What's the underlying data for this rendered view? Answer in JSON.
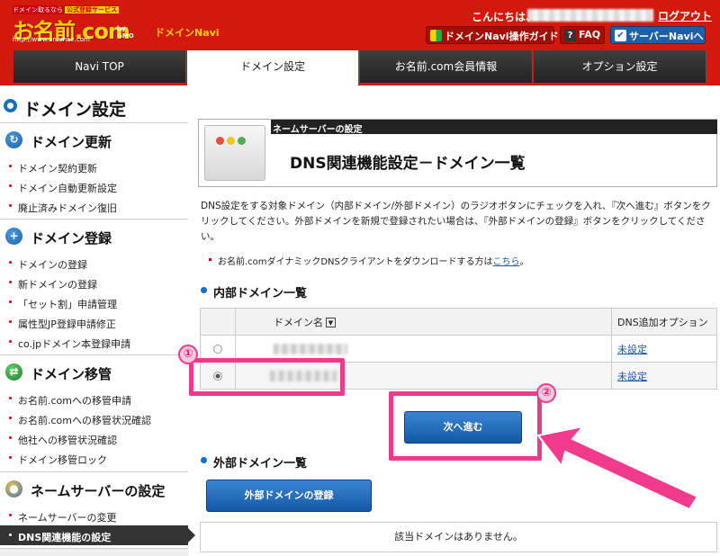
{
  "header": {
    "logo_tagline": "ドメイン取るなら",
    "logo_tagline_badge": "公式登録サービス",
    "logo_main": "お名前.com",
    "logo_gmo": "by GMO",
    "logo_url": "http://www.onamae.com",
    "navi_name": "ドメインNavi",
    "greeting": "こんにちは、",
    "logout": "ログアウト",
    "buttons": [
      {
        "label": "ドメインNavi操作ガイド",
        "icon": "beginner-mark-icon"
      },
      {
        "label": "FAQ",
        "icon": "question-icon"
      },
      {
        "label": "サーバーNaviへ",
        "icon": "server-check-icon"
      }
    ]
  },
  "tabs": [
    {
      "label": "Navi TOP",
      "active": false
    },
    {
      "label": "ドメイン設定",
      "active": true
    },
    {
      "label": "お名前.com会員情報",
      "active": false
    },
    {
      "label": "オプション設定",
      "active": false
    }
  ],
  "page_title": "ドメイン設定",
  "sidebar": {
    "sections": [
      {
        "title": "ドメイン更新",
        "icon": "refresh-icon",
        "items": [
          "ドメイン契約更新",
          "ドメイン自動更新設定",
          "廃止済みドメイン復旧"
        ]
      },
      {
        "title": "ドメイン登録",
        "icon": "plus-icon",
        "items": [
          "ドメインの登録",
          "新ドメインの登録",
          "「セット割」申請管理",
          "属性型JP登録申請修正",
          "co.jpドメイン本登録申請"
        ]
      },
      {
        "title": "ドメイン移管",
        "icon": "transfer-icon",
        "items": [
          "お名前.comへの移管申請",
          "お名前.comへの移管状況確認",
          "他社への移管状況確認",
          "ドメイン移管ロック"
        ]
      },
      {
        "title": "ネームサーバーの設定",
        "icon": "users-icon",
        "items": [
          "ネームサーバーの変更",
          "DNS関連機能の設定"
        ]
      }
    ],
    "active_item": "DNS関連機能の設定"
  },
  "card": {
    "section_label": "ネームサーバーの設定",
    "title": "DNS関連機能設定－ドメイン一覧"
  },
  "description": "DNS設定をする対象ドメイン（内部ドメイン/外部ドメイン）のラジオボタンにチェックを入れ、『次へ進む』ボタンをクリックしてください。外部ドメインを新規で登録されたい場合は、『外部ドメインの登録』ボタンをクリックしてください。",
  "note": {
    "text": "お名前.comダイナミックDNSクライアントをダウンロードする方は",
    "link": "こちら",
    "suffix": "。"
  },
  "internal": {
    "heading": "内部ドメイン一覧",
    "columns": [
      "",
      "ドメイン名",
      "DNS追加オプション"
    ],
    "rows": [
      {
        "selected": false,
        "option": "未設定"
      },
      {
        "selected": true,
        "option": "未設定"
      }
    ],
    "next_button": "次へ進む"
  },
  "external": {
    "heading": "外部ドメイン一覧",
    "register_button": "外部ドメインの登録",
    "empty_text": "該当ドメインはありません。"
  },
  "annotations": {
    "marker1": "①",
    "marker2": "②",
    "color": "#f03a8c"
  },
  "colors": {
    "header_red": "#d3190b",
    "logo_yellow": "#ffd400",
    "button_blue": "#1d5fa8",
    "link_blue": "#1a55b0"
  }
}
